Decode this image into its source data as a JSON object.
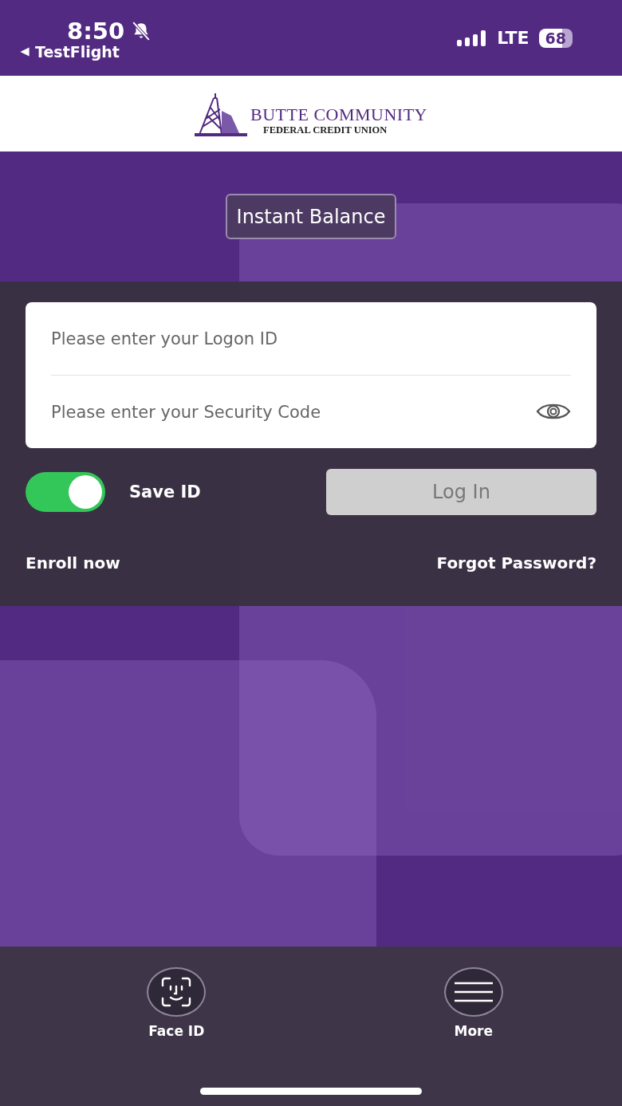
{
  "status_bar": {
    "time": "8:50",
    "back_label": "TestFlight",
    "network": "LTE",
    "battery": "68"
  },
  "header": {
    "logo_line_1": "BUTTE COMMUNITY",
    "logo_line_2": "FEDERAL CREDIT UNION"
  },
  "instant_balance_button": "Instant Balance",
  "login_form": {
    "logon_id": {
      "placeholder": "Please enter your Logon ID"
    },
    "security_code": {
      "placeholder": "Please enter your Security Code"
    }
  },
  "save_id": {
    "label": "Save ID",
    "on": true
  },
  "login_button": {
    "label": "Log In",
    "disabled": true
  },
  "links": {
    "enroll": "Enroll now",
    "forgot_password": "Forgot Password?"
  },
  "bottom_bar": [
    {
      "kind": "face",
      "label": "Face ID"
    },
    {
      "kind": "menu",
      "label": "More"
    }
  ]
}
